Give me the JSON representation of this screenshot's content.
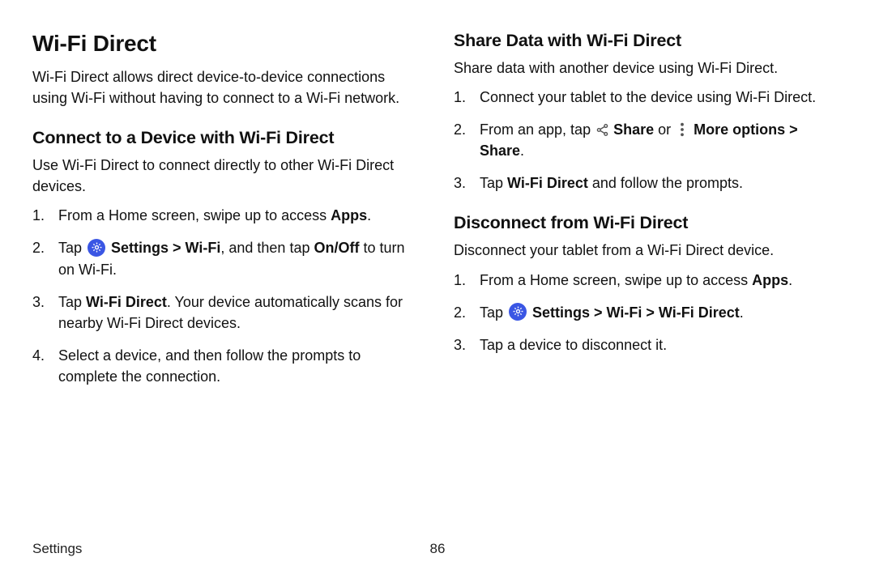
{
  "col1": {
    "h1": "Wi-Fi Direct",
    "intro": "Wi-Fi Direct allows direct device-to-device connections using Wi-Fi without having to connect to a Wi-Fi network.",
    "sec1": {
      "h2": "Connect to a Device with Wi-Fi Direct",
      "p": "Use Wi-Fi Direct to connect directly to other Wi-Fi Direct devices.",
      "li1_a": "From a Home screen, swipe up to access ",
      "li1_b": "Apps",
      "li1_c": ".",
      "li2_a": "Tap ",
      "li2_b": " Settings > Wi-Fi",
      "li2_c": ", and then tap ",
      "li2_d": "On/Off",
      "li2_e": " to turn on Wi-Fi.",
      "li3_a": "Tap ",
      "li3_b": "Wi-Fi Direct",
      "li3_c": ". Your device automatically scans for nearby Wi-Fi Direct devices.",
      "li4": "Select a device, and then follow the prompts to complete the connection."
    }
  },
  "col2": {
    "sec1": {
      "h2": "Share Data with Wi-Fi Direct",
      "p": "Share data with another device using Wi-Fi Direct.",
      "li1": "Connect your tablet to the device using Wi-Fi Direct.",
      "li2_a": "From an app, tap ",
      "li2_b": " Share",
      "li2_c": " or ",
      "li2_d": " More options > Share",
      "li2_e": ".",
      "li3_a": "Tap ",
      "li3_b": "Wi-Fi Direct",
      "li3_c": " and follow the prompts."
    },
    "sec2": {
      "h2": "Disconnect from Wi-Fi Direct",
      "p": "Disconnect your tablet from a Wi-Fi Direct device.",
      "li1_a": "From a Home screen, swipe up to access ",
      "li1_b": "Apps",
      "li1_c": ".",
      "li2_a": "Tap ",
      "li2_b": " Settings > Wi-Fi > Wi-Fi Direct",
      "li2_c": ".",
      "li3": "Tap a device to disconnect it."
    }
  },
  "footer": {
    "section": "Settings",
    "page": "86"
  }
}
